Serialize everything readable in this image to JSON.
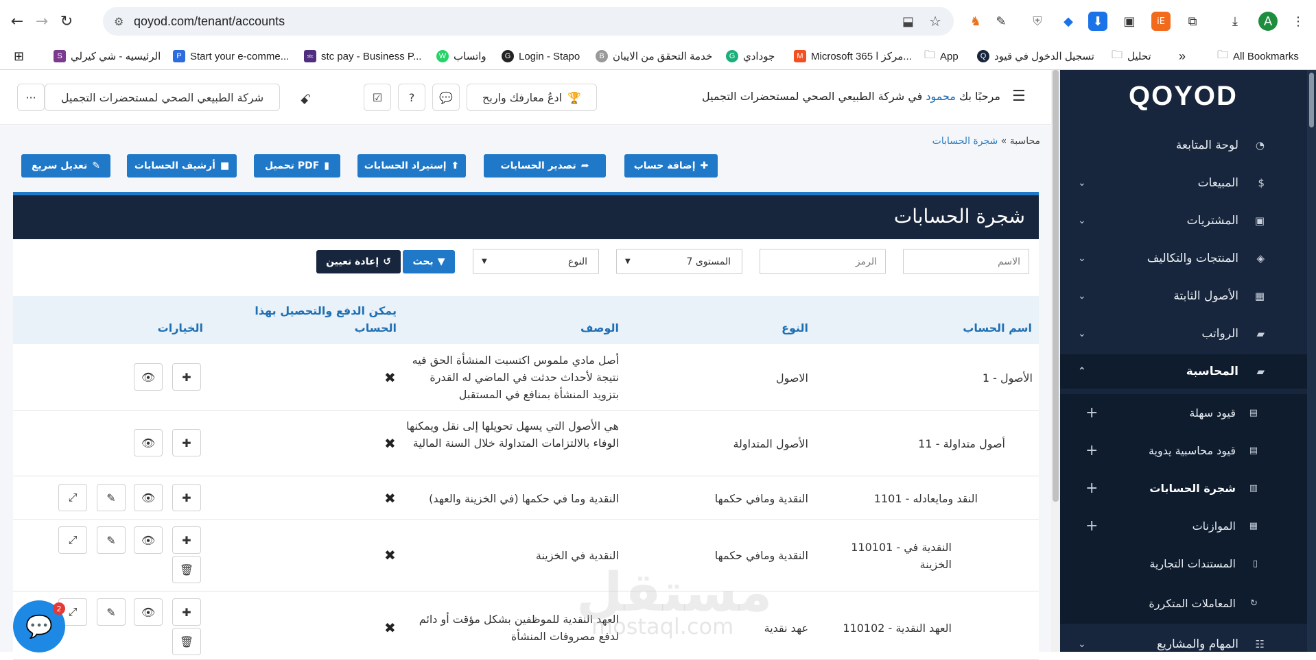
{
  "browser": {
    "url": "qoyod.com/tenant/accounts",
    "bookmarks": [
      {
        "label": "الرئيسيه - شي كيرلي",
        "icon": "S",
        "color": "#7a3b8f"
      },
      {
        "label": "Start your e-comme...",
        "icon": "P",
        "color": "#2d6cdf"
      },
      {
        "label": "stc pay - Business P...",
        "icon": "stc",
        "color": "#4f2d7f"
      },
      {
        "label": "واتساب",
        "icon": "W",
        "color": "#25d366"
      },
      {
        "label": "Login - Stapo",
        "icon": "G",
        "color": "#222222"
      },
      {
        "label": "خدمة التحقق من الايبان",
        "icon": "B",
        "color": "#999999"
      },
      {
        "label": "جودادي",
        "icon": "G",
        "color": "#1bb07a"
      },
      {
        "label": "Microsoft 365 مركز ا...",
        "icon": "M",
        "color": "#f25022"
      },
      {
        "label": "App",
        "icon": "folder",
        "color": "#555555"
      },
      {
        "label": "تسجيل الدخول في قيود",
        "icon": "Q",
        "color": "#17263c"
      },
      {
        "label": "تحليل",
        "icon": "folder",
        "color": "#555555"
      }
    ],
    "all_bookmarks": "All Bookmarks",
    "avatar_letter": "A"
  },
  "sidebar": {
    "logo": "QOYOD",
    "items": [
      {
        "label": "لوحة المتابعة",
        "icon": "◔",
        "chevron": ""
      },
      {
        "label": "المبيعات",
        "icon": "$",
        "chevron": "⌄"
      },
      {
        "label": "المشتريات",
        "icon": "▣",
        "chevron": "⌄"
      },
      {
        "label": "المنتجات والتكاليف",
        "icon": "◈",
        "chevron": "⌄"
      },
      {
        "label": "الأصول الثابتة",
        "icon": "▦",
        "chevron": "⌄"
      },
      {
        "label": "الرواتب",
        "icon": "▰",
        "chevron": "⌄"
      },
      {
        "label": "المحاسبة",
        "icon": "▰",
        "chevron": "⌃"
      }
    ],
    "sub_items": [
      {
        "label": "قيود سهلة",
        "icon": "▤",
        "plus": "+"
      },
      {
        "label": "قيود محاسبية يدوية",
        "icon": "▤",
        "plus": "+"
      },
      {
        "label": "شجرة الحسابات",
        "icon": "▥",
        "plus": "+"
      },
      {
        "label": "الموازنات",
        "icon": "▦",
        "plus": "+"
      },
      {
        "label": "المستندات التجارية",
        "icon": "▯",
        "plus": ""
      },
      {
        "label": "المعاملات المتكررة",
        "icon": "↻",
        "plus": ""
      }
    ],
    "last_item": {
      "label": "المهام والمشاريع",
      "icon": "☷",
      "chevron": "⌄"
    }
  },
  "header": {
    "welcome_prefix": "مرحبًا بك",
    "user_name": "محمود",
    "welcome_suffix": "في شركة الطبيعي الصحي لمستحضرات التجميل",
    "refer_label": "ادعُ معارفك واربح",
    "company_name": "شركة الطبيعي الصحي لمستحضرات التجميل",
    "more": "···"
  },
  "breadcrumb": {
    "parent": "محاسبة",
    "sep": "»",
    "current": "شجرة الحسابات"
  },
  "toolbar": {
    "add": "إضافة حساب",
    "export": "تصدير الحسابات",
    "import": "إستيراد الحسابات",
    "pdf": "تحميل PDF",
    "archive": "أرشيف الحسابات",
    "quick_edit": "تعديل سريع"
  },
  "panel": {
    "title": "شجرة الحسابات"
  },
  "filters": {
    "name_placeholder": "الاسم",
    "code_placeholder": "الرمز",
    "level_value": "المستوى 7",
    "type_placeholder": "النوع",
    "search_label": "بحث",
    "reset_label": "إعادة تعيين"
  },
  "table": {
    "headers": {
      "name": "اسم الحساب",
      "type": "النوع",
      "desc": "الوصف",
      "payable_l1": "يمكن الدفع والتحصيل بهذا",
      "payable_l2": "الحساب",
      "options": "الخيارات"
    },
    "rows": [
      {
        "name": "1 - الأصول",
        "type": "الاصول",
        "desc": "أصل مادي ملموس اكتسبت المنشأة الحق فيه نتيجة لأحداث حدثت في الماضي له القدرة بتزويد المنشأة بمنافع في المستقبل",
        "payable": "✖"
      },
      {
        "name": "11 - أصول متداولة",
        "type": "الأصول المتداولة",
        "desc": "هي الأصول التي يسهل تحويلها إلى نقل ويمكنها الوفاء بالالتزامات المتداولة خلال السنة المالية",
        "payable": "✖"
      },
      {
        "name": "1101 - النقد ومايعادله",
        "type": "النقدية ومافي حكمها",
        "desc": "النقدية وما في حكمها (في الخزينة والعهد)",
        "payable": "✖"
      },
      {
        "name": "110101 - النقدية في الخزينة",
        "type": "النقدية ومافي حكمها",
        "desc": "النقدية في الخزينة",
        "payable": "✖"
      },
      {
        "name": "110102 - العهد النقدية",
        "type": "عهد نقدية",
        "desc": "العهد النقدية للموظفين بشكل مؤقت أو دائم لدفع مصروفات المنشأة",
        "payable": "✖"
      }
    ]
  },
  "watermark": {
    "ar": "مستقل",
    "en": "mostaql.com"
  },
  "chat_badge": "2"
}
